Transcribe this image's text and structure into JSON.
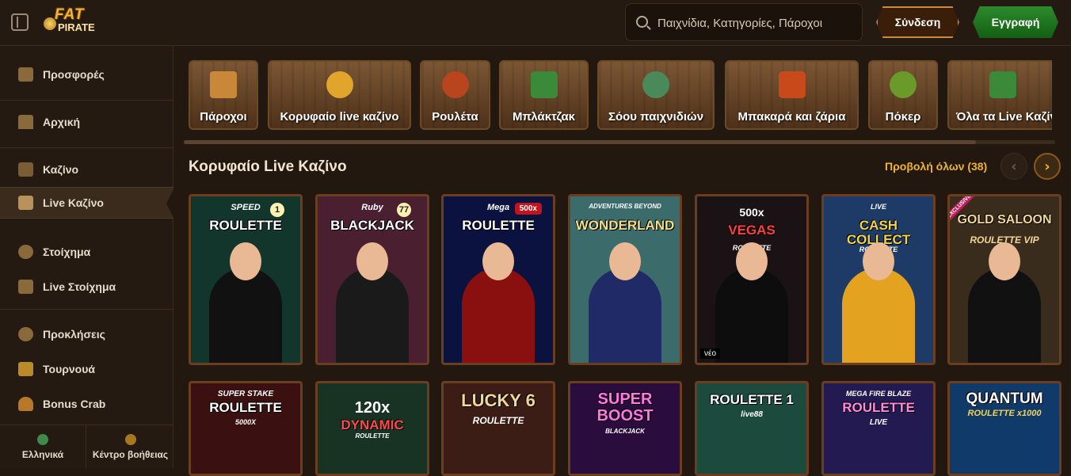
{
  "header": {
    "logo_line1": "FAT",
    "logo_line2": "PIRATE",
    "search_placeholder": "Παιχνίδια, Κατηγορίες, Πάροχοι",
    "login_label": "Σύνδεση",
    "register_label": "Εγγραφή"
  },
  "sidebar": {
    "items": [
      {
        "label": "Προσφορές",
        "icon": "chest-icon"
      },
      {
        "label": "Αρχική",
        "icon": "house-icon"
      },
      {
        "label": "Καζίνο",
        "icon": "slot-icon"
      },
      {
        "label": "Live Καζίνο",
        "icon": "card-icon"
      },
      {
        "label": "Στοίχημα",
        "icon": "ball-icon"
      },
      {
        "label": "Live Στοίχημα",
        "icon": "live-icon"
      },
      {
        "label": "Προκλήσεις",
        "icon": "medal-icon"
      },
      {
        "label": "Τουρνουά",
        "icon": "trophy-icon"
      },
      {
        "label": "Bonus Crab",
        "icon": "crab-icon"
      }
    ],
    "footer": {
      "language_label": "Ελληνικά",
      "help_label": "Κέντρο βοήθειας"
    }
  },
  "categories": [
    {
      "label": "Πάροχοι"
    },
    {
      "label": "Κορυφαίο live καζίνο"
    },
    {
      "label": "Ρουλέτα"
    },
    {
      "label": "Μπλάκτζακ"
    },
    {
      "label": "Σόου παιχνιδιών"
    },
    {
      "label": "Μπακαρά και ζάρια"
    },
    {
      "label": "Πόκερ"
    },
    {
      "label": "Όλα τα Live Καζίνο"
    }
  ],
  "section": {
    "title": "Κορυφαίο Live Καζίνο",
    "view_all": "Προβολή όλων (38)",
    "prev_icon": "chevron-left-icon",
    "next_icon": "chevron-right-icon"
  },
  "games_row1": [
    {
      "sub": "SPEED",
      "title": "ROULETTE",
      "num": "1",
      "bg": "#12362c"
    },
    {
      "sub": "Ruby",
      "title": "BLACKJACK",
      "num": "77",
      "bg": "#4a1f2f"
    },
    {
      "sub": "Mega",
      "title": "ROULETTE",
      "mult": "500x",
      "bg": "#0b1240"
    },
    {
      "sub": "ADVENTURES BEYOND",
      "title": "WONDERLAND",
      "bg": "#3b6b6a"
    },
    {
      "mult_top": "500x",
      "title": "VEGAS",
      "sub2": "ROULETTE",
      "badge": "νέο",
      "bg": "#1a1215"
    },
    {
      "sub": "LIVE",
      "title": "CASH COLLECT",
      "sub2": "ROULETTE",
      "bg": "#1e3a66"
    },
    {
      "ribbon": "EXCLUSIVE",
      "title": "GOLD SALOON",
      "sub2": "ROULETTE VIP",
      "bg": "#3a2c1c"
    }
  ],
  "games_row2": [
    {
      "sub": "SUPER STAKE",
      "title": "ROULETTE",
      "sub2": "5000X",
      "bg": "#3a1010"
    },
    {
      "mult_top": "120x",
      "title": "DYNAMIC",
      "sub2": "ROULETTE",
      "bg": "#183323"
    },
    {
      "title": "LUCKY 6",
      "sub2": "ROULETTE",
      "bg": "#3b1d16"
    },
    {
      "title": "SUPER BOOST",
      "sub2": "BLACKJACK",
      "bg": "#2a0c3d"
    },
    {
      "title": "ROULETTE 1",
      "sub2": "live88",
      "bg": "#1c4a3c"
    },
    {
      "sub": "MEGA FIRE BLAZE",
      "title": "ROULETTE",
      "sub2": "LIVE",
      "bg": "#231a52"
    },
    {
      "title": "QUANTUM",
      "sub2": "ROULETTE x1000",
      "bg": "#103a6a"
    }
  ],
  "colors": {
    "accent_gold": "#f0b52e",
    "register_green": "#2c8a2c",
    "background": "#22180f"
  }
}
